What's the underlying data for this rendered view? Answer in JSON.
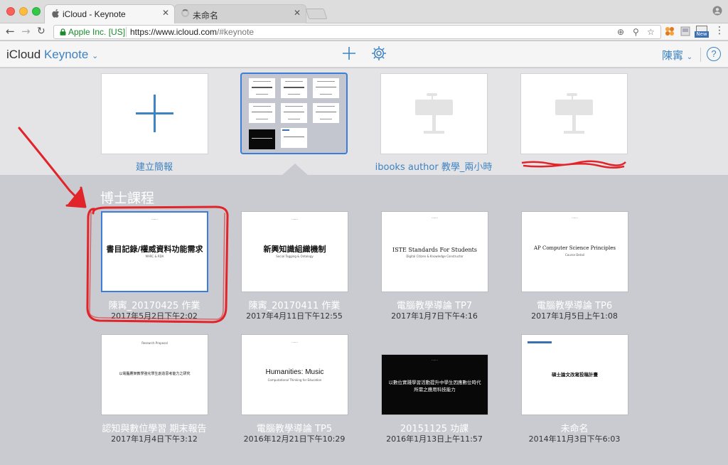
{
  "browser": {
    "tabs": [
      {
        "title": "iCloud - Keynote",
        "close": "✕"
      },
      {
        "title": "未命名",
        "close": "✕"
      }
    ],
    "address": {
      "org": "Apple Inc. [US]",
      "url_host": "https://www.icloud.com",
      "url_path": "/#keynote"
    },
    "ext_badge": "New"
  },
  "app": {
    "brand": "iCloud",
    "product": "Keynote",
    "user": "陳寗",
    "help": "?"
  },
  "top_row": [
    {
      "label": "建立簡報",
      "type": "create"
    },
    {
      "label": "",
      "type": "preview"
    },
    {
      "label": "ibooks author 教學_兩小時",
      "type": "placeholder"
    },
    {
      "label": "",
      "type": "placeholder-redacted"
    }
  ],
  "folder": {
    "title": "博士課程",
    "docs": [
      {
        "name": "陳寗_20170425 作業",
        "date": "2017年5月2日下午2:02",
        "thumb_title": "書目記錄/權威資料功能需求",
        "thumb_sub": "MARC & RDA"
      },
      {
        "name": "陳寗_20170411 作業",
        "date": "2017年4月11日下午12:55",
        "thumb_title": "新興知識組織機制",
        "thumb_sub": "Social Tagging & Ontology"
      },
      {
        "name": "電腦教學導論 TP7",
        "date": "2017年1月7日下午4:16",
        "thumb_title": "ISTE Standards For Students",
        "thumb_sub": "Digital Citizen & Knowledge Constructor"
      },
      {
        "name": "電腦教學導論 TP6",
        "date": "2017年1月5日上午1:08",
        "thumb_title": "AP Computer Science Principles",
        "thumb_sub": "Course Detail"
      },
      {
        "name": "認知與數位學習 期末報告",
        "date": "2017年1月4日下午3:12",
        "thumb_title": "以電腦鷹架教學強化學生創造思考能力之研究",
        "thumb_sub": "Research Proposal"
      },
      {
        "name": "電腦教學導論 TP5",
        "date": "2016年12月21日下午10:29",
        "thumb_title": "Humanities: Music",
        "thumb_sub": "Computational Thinking for Education"
      },
      {
        "name": "20151125 功課",
        "date": "2016年1月13日上午11:57",
        "thumb_title": "以數位實踐學習活動提升中學生因應數位時代",
        "thumb_title2": "所需之應用科技能力",
        "thumb_sub": ""
      },
      {
        "name": "未命名",
        "date": "2014年11月3日下午6:03",
        "thumb_title": "碩士論文改寫投稿計畫",
        "thumb_sub": ""
      }
    ]
  },
  "colors": {
    "accent": "#3e83c2",
    "selection": "#3b7dd8",
    "annotation": "#e0242a",
    "folder_bg": "#c9cbd0"
  }
}
